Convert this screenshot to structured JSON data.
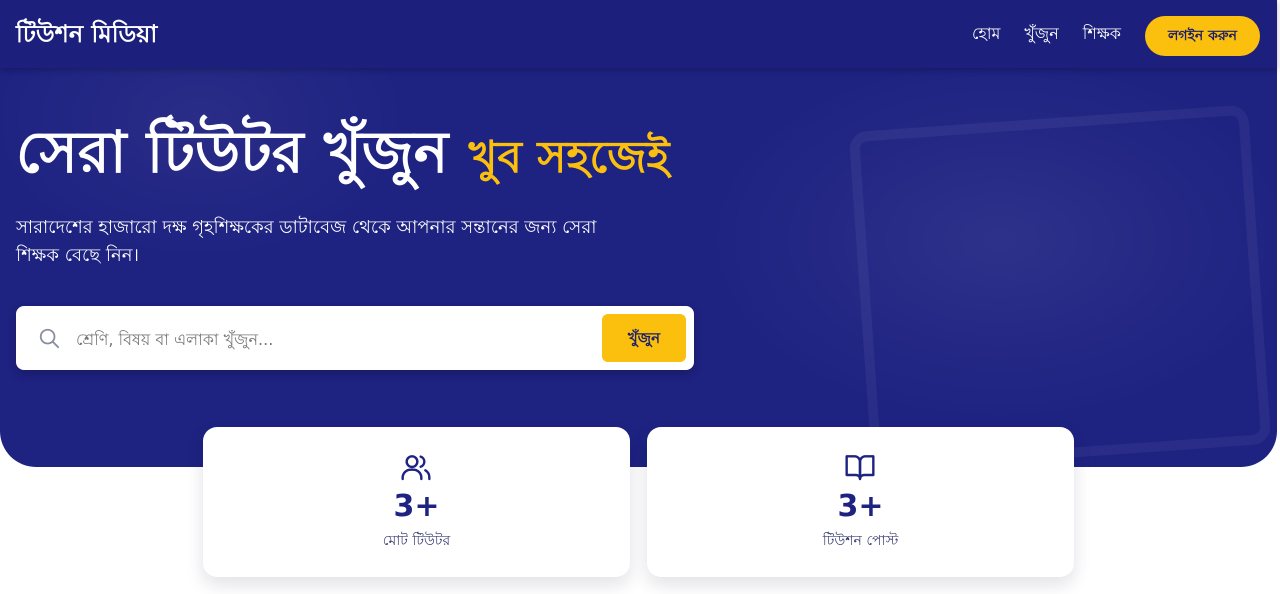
{
  "brand": "টিউশন মিডিয়া",
  "nav": {
    "links": [
      "হোম",
      "খুঁজুন",
      "শিক্ষক"
    ],
    "login_label": "লগইন করুন"
  },
  "hero": {
    "headline_main": "সেরা টিউটর খুঁজুন",
    "headline_highlight": "খুব সহজেই",
    "subtitle": "সারাদেশের হাজারো দক্ষ গৃহশিক্ষকের ডাটাবেজ থেকে আপনার সন্তানের জন্য সেরা শিক্ষক বেছে নিন।"
  },
  "search": {
    "placeholder": "শ্রেণি, বিষয় বা এলাকা খুঁজুন...",
    "value": "",
    "button_label": "খুঁজুন"
  },
  "stats": [
    {
      "icon": "users-icon",
      "value": "3+",
      "label": "মোট টিউটর"
    },
    {
      "icon": "book-open-icon",
      "value": "3+",
      "label": "টিউশন পোস্ট"
    }
  ],
  "colors": {
    "primary": "#1e2281",
    "accent": "#fbbf0e",
    "background": "#ffffff"
  }
}
